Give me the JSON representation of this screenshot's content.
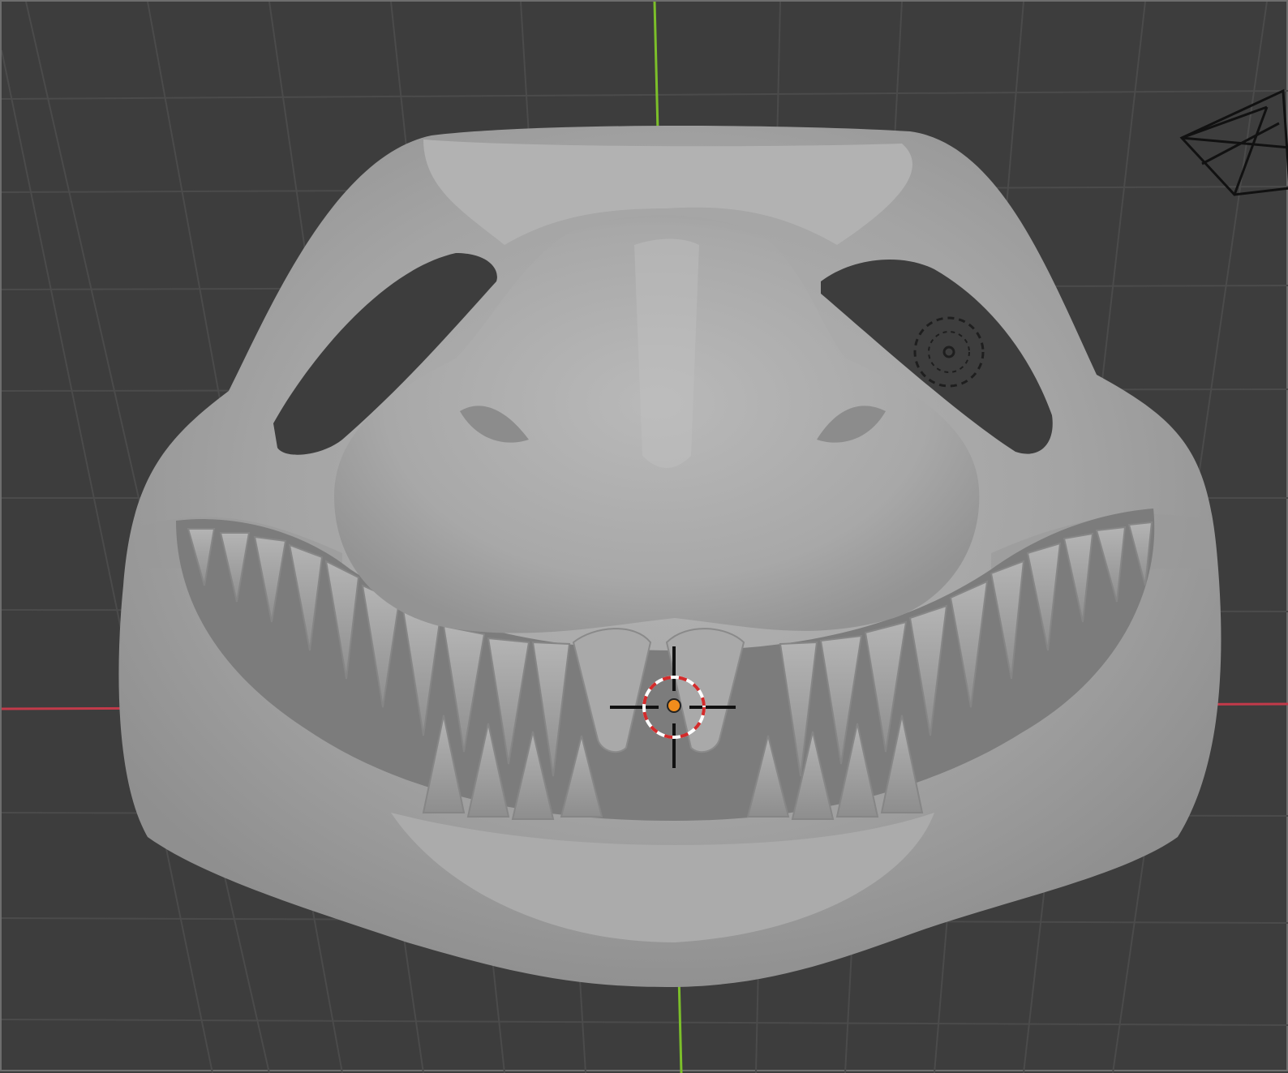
{
  "viewport": {
    "background_color": "#3d3d3d",
    "grid_color": "#4c4c4c",
    "x_axis_color": "#c23a4a",
    "y_axis_color": "#7cbf2a"
  },
  "scene": {
    "mesh_object": "sculpted-mask",
    "mesh_color": "#a9a9a9",
    "objects": [
      {
        "name": "camera-icon"
      },
      {
        "name": "light-icon"
      },
      {
        "name": "3d-cursor"
      },
      {
        "name": "object-origin"
      }
    ]
  }
}
